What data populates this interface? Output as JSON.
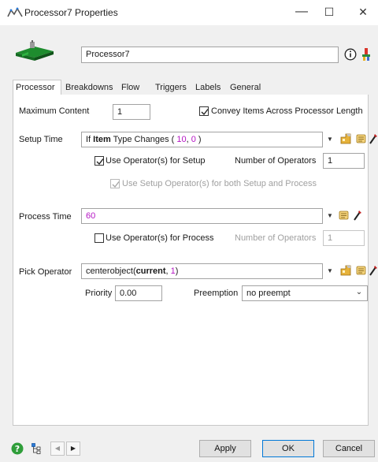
{
  "window": {
    "title": "Processor7 Properties",
    "minimize_glyph": "—",
    "maximize_glyph": "☐",
    "close_glyph": "✕"
  },
  "header": {
    "object_name": "Processor7",
    "info_icon": "info-icon",
    "edit_icon": "paint-icon"
  },
  "tabs": [
    {
      "label": "Processor"
    },
    {
      "label": "Breakdowns"
    },
    {
      "label": "Flow"
    },
    {
      "label": "Triggers"
    },
    {
      "label": "Labels"
    },
    {
      "label": "General"
    }
  ],
  "processor": {
    "max_content_label": "Maximum Content",
    "max_content_value": "1",
    "convey_label": "Convey Items Across Processor Length",
    "convey_checked": true,
    "setup_time_label": "Setup Time",
    "setup_time_value": {
      "prefix": "If ",
      "keyword": "Item",
      "middle": " Type Changes ( ",
      "num1": "10",
      "sep": ", ",
      "num2": "0",
      "suffix": " )"
    },
    "use_operators_setup_label": "Use Operator(s) for Setup",
    "use_operators_setup_checked": true,
    "num_operators_label": "Number of Operators",
    "num_operators_value": "1",
    "use_setup_both_label": "Use Setup Operator(s) for both Setup and Process",
    "use_setup_both_checked": true,
    "process_time_label": "Process Time",
    "process_time_value": "60",
    "use_operators_process_label": "Use Operator(s) for Process",
    "use_operators_process_checked": false,
    "num_operators_process_label": "Number of Operators",
    "num_operators_process_value": "1",
    "pick_operator_label": "Pick Operator",
    "pick_operator_value": {
      "fn": "centerobject",
      "open": "(",
      "arg": "current",
      "sep": ", ",
      "num": "1",
      "close": ")"
    },
    "priority_label": "Priority",
    "priority_value": "0.00",
    "preemption_label": "Preemption",
    "preemption_value": "no preempt"
  },
  "footer": {
    "apply_label": "Apply",
    "ok_label": "OK",
    "cancel_label": "Cancel"
  },
  "colors": {
    "accent": "#0078d7",
    "code_number": "#b515c4"
  }
}
